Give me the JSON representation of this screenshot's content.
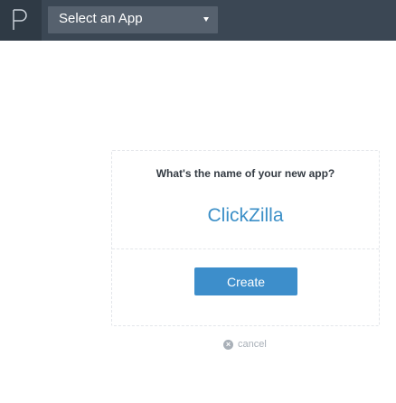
{
  "header": {
    "logo_icon": "p-logo-icon",
    "app_select": {
      "selected": "Select an App",
      "icon": "caret-down-icon"
    }
  },
  "form": {
    "prompt": "What's the name of your new app?",
    "app_name_value": "ClickZilla",
    "create_label": "Create",
    "cancel_label": "cancel",
    "cancel_icon": "x-circle-icon"
  },
  "colors": {
    "topbar": "#3b4754",
    "accent": "#3d8ecb",
    "input_text": "#3b8fc7"
  }
}
